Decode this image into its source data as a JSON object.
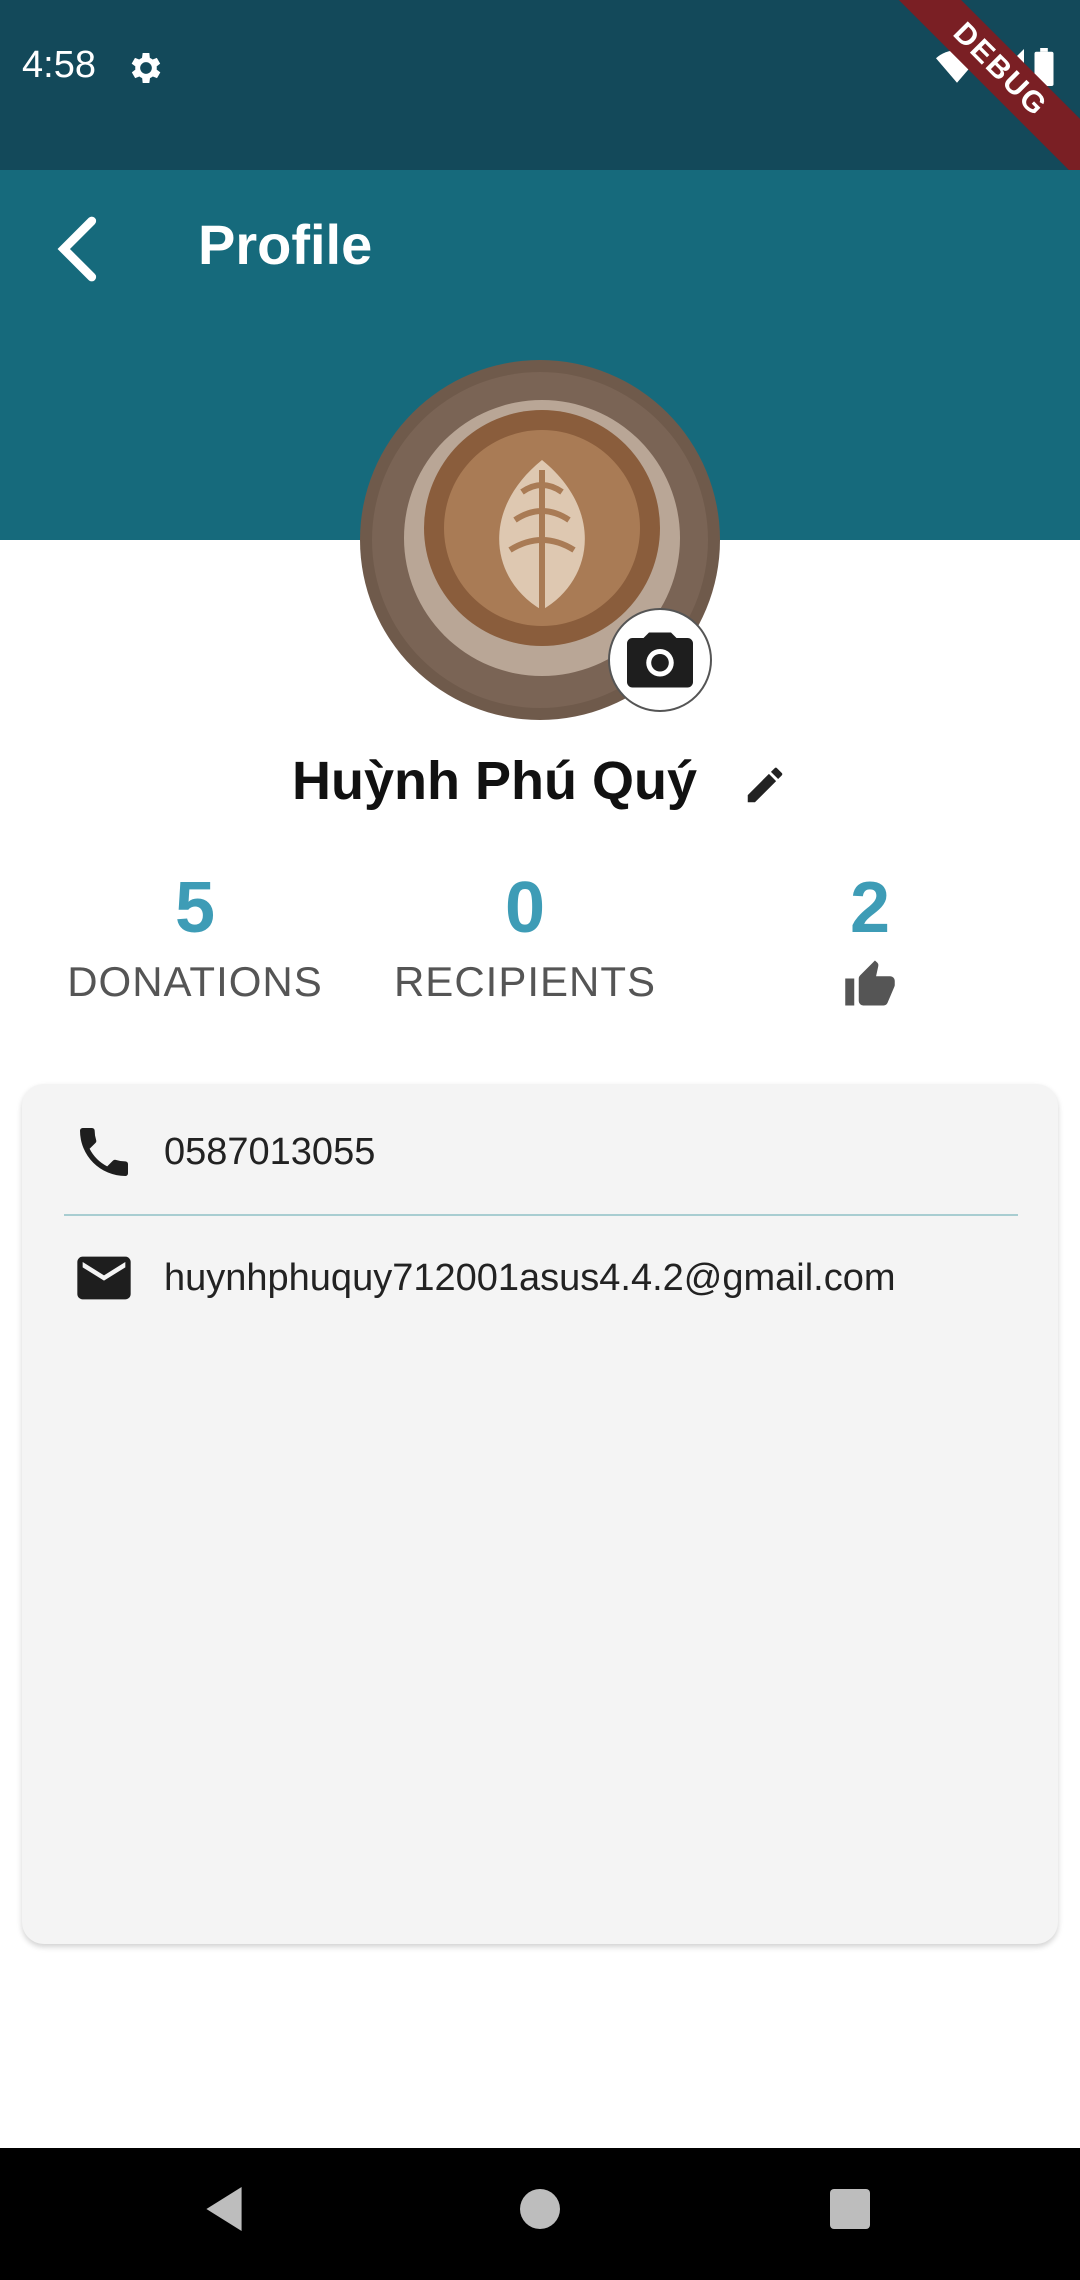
{
  "status": {
    "time": "4:58",
    "debug_label": "DEBUG"
  },
  "appbar": {
    "title": "Profile"
  },
  "profile": {
    "name": "Huỳnh Phú Quý"
  },
  "stats": [
    {
      "value": "5",
      "label": "DONATIONS"
    },
    {
      "value": "0",
      "label": "RECIPIENTS"
    },
    {
      "value": "2",
      "label": ""
    }
  ],
  "contact": {
    "phone": "0587013055",
    "email": "huynhphuquy712001asus4.4.2@gmail.com"
  },
  "colors": {
    "statusbar": "#13495a",
    "appbar": "#166a7c",
    "accent": "#3e9cb6"
  },
  "icons": [
    "settings-gear-icon",
    "wifi-icon",
    "signal-icon",
    "battery-icon",
    "back-arrow-icon",
    "camera-icon",
    "edit-pencil-icon",
    "thumbs-up-icon",
    "phone-icon",
    "mail-icon",
    "nav-back-icon",
    "nav-home-icon",
    "nav-recents-icon"
  ]
}
